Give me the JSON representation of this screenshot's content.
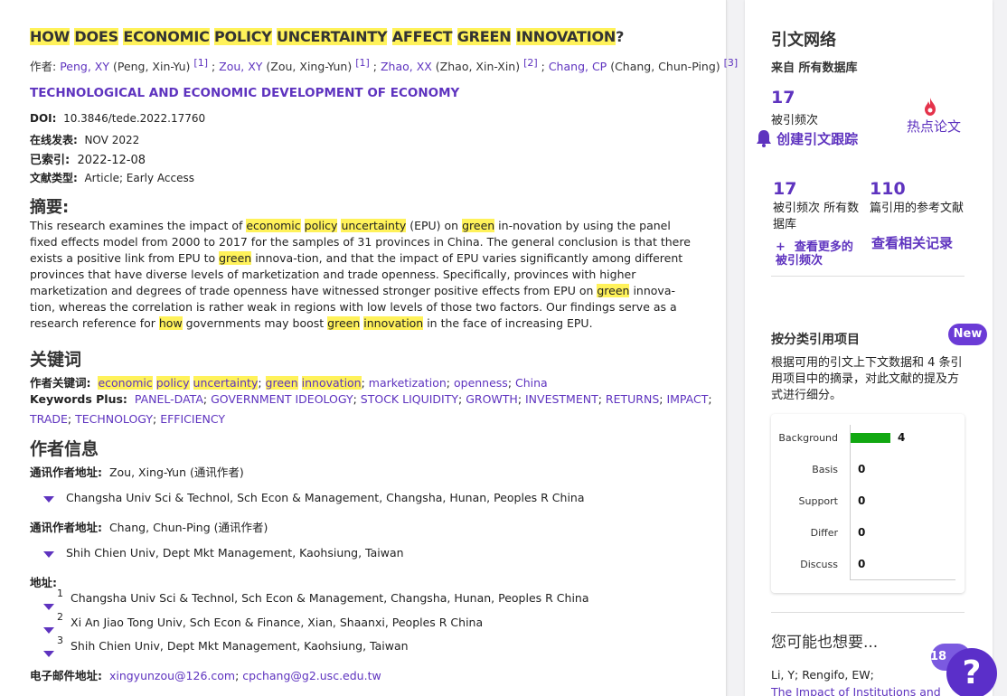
{
  "article": {
    "title_words": [
      {
        "t": "HOW",
        "hl": true
      },
      {
        "t": " ",
        "hl": false
      },
      {
        "t": "DOES",
        "hl": true
      },
      {
        "t": " ",
        "hl": false
      },
      {
        "t": "ECONOMIC",
        "hl": true
      },
      {
        "t": " ",
        "hl": false
      },
      {
        "t": "POLICY",
        "hl": true
      },
      {
        "t": " ",
        "hl": false
      },
      {
        "t": "UNCERTAINTY",
        "hl": true
      },
      {
        "t": " ",
        "hl": false
      },
      {
        "t": "AFFECT",
        "hl": true
      },
      {
        "t": " ",
        "hl": false
      },
      {
        "t": "GREEN",
        "hl": true
      },
      {
        "t": " ",
        "hl": false
      },
      {
        "t": "INNOVATION",
        "hl": true
      },
      {
        "t": "?",
        "hl": false
      }
    ],
    "authors_label": "作者:",
    "authors": [
      {
        "short": "Peng, XY",
        "full": "(Peng, Xin-Yu)",
        "ref": "[1]"
      },
      {
        "short": "Zou, XY",
        "full": "(Zou, Xing-Yun)",
        "ref": "[1]"
      },
      {
        "short": "Zhao, XX",
        "full": "(Zhao, Xin-Xin)",
        "ref": "[2]"
      },
      {
        "short": "Chang, CP",
        "full": "(Chang, Chun-Ping)",
        "ref": "[3]"
      }
    ],
    "journal": "TECHNOLOGICAL AND ECONOMIC DEVELOPMENT OF ECONOMY",
    "doi_label": "DOI:",
    "doi": "10.3846/tede.2022.17760",
    "online_label": "在线发表:",
    "online": "NOV 2022",
    "indexed_label": "已索引:",
    "indexed": "2022-12-08",
    "doctype_label": "文献类型:",
    "doctype": "Article; Early Access",
    "abstract_heading": "摘要:",
    "abstract_parts": [
      {
        "t": "This research examines the impact of ",
        "hl": false
      },
      {
        "t": "economic",
        "hl": true
      },
      {
        "t": " ",
        "hl": false
      },
      {
        "t": "policy",
        "hl": true
      },
      {
        "t": " ",
        "hl": false
      },
      {
        "t": "uncertainty",
        "hl": true
      },
      {
        "t": " (EPU) on ",
        "hl": false
      },
      {
        "t": "green",
        "hl": true
      },
      {
        "t": " in-novation by using the panel fixed effects model from 2000 to 2017 for the samples of 31 provinces in China. The general conclusion is that there exists a positive link from EPU to ",
        "hl": false
      },
      {
        "t": "green",
        "hl": true
      },
      {
        "t": " innova-tion, and that the impact of EPU varies significantly among different provinces that have diverse levels of marketization and trade openness. Specifically, provinces with higher marketization and degrees of trade openness have witnessed stronger positive effects from EPU on ",
        "hl": false
      },
      {
        "t": "green",
        "hl": true
      },
      {
        "t": " innova-tion, whereas the correlation is rather weak in regions with low levels of those two factors. Our findings serve as a research reference for ",
        "hl": false
      },
      {
        "t": "how",
        "hl": true
      },
      {
        "t": " governments may boost ",
        "hl": false
      },
      {
        "t": "green",
        "hl": true
      },
      {
        "t": " ",
        "hl": false
      },
      {
        "t": "innovation",
        "hl": true
      },
      {
        "t": " in the face of increasing EPU.",
        "hl": false
      }
    ],
    "keywords_heading": "关键词",
    "author_kw_label": "作者关键词:",
    "author_kw": [
      [
        {
          "t": "economic",
          "hl": true
        },
        {
          "t": " ",
          "hl": false
        },
        {
          "t": "policy",
          "hl": true
        },
        {
          "t": " ",
          "hl": false
        },
        {
          "t": "uncertainty",
          "hl": true
        }
      ],
      [
        {
          "t": "green",
          "hl": true
        },
        {
          "t": " ",
          "hl": false
        },
        {
          "t": "innovation",
          "hl": true
        }
      ],
      [
        {
          "t": "marketization",
          "hl": false
        }
      ],
      [
        {
          "t": "openness",
          "hl": false
        }
      ],
      [
        {
          "t": "China",
          "hl": false
        }
      ]
    ],
    "kw_plus_label": "Keywords Plus:",
    "kw_plus_line1": [
      "PANEL-DATA",
      "GOVERNMENT IDEOLOGY",
      "STOCK LIQUIDITY",
      "GROWTH",
      "INVESTMENT",
      "RETURNS",
      "IMPACT"
    ],
    "kw_plus_line2": [
      "TRADE",
      "TECHNOLOGY",
      "EFFICIENCY"
    ],
    "author_info_heading": "作者信息",
    "corr1_label": "通讯作者地址:",
    "corr1_name": "Zou, Xing-Yun (通讯作者)",
    "corr1_addr": "Changsha Univ Sci & Technol, Sch Econ & Management, Changsha, Hunan, Peoples R China",
    "corr2_label": "通讯作者地址:",
    "corr2_name": "Chang, Chun-Ping (通讯作者)",
    "corr2_addr": "Shih Chien Univ, Dept Mkt Management, Kaohsiung, Taiwan",
    "addr_label": "地址:",
    "addresses": [
      {
        "n": "1",
        "text": "Changsha Univ Sci & Technol, Sch Econ & Management, Changsha, Hunan, Peoples R China"
      },
      {
        "n": "2",
        "text": "Xi An Jiao Tong Univ, Sch Econ & Finance, Xian, Shaanxi, Peoples R China"
      },
      {
        "n": "3",
        "text": "Shih Chien Univ, Dept Mkt Management, Kaohsiung, Taiwan"
      }
    ],
    "email_label": "电子邮件地址:",
    "emails": [
      "xingyunzou@126.com",
      "cpchang@g2.usc.edu.tw"
    ]
  },
  "sidebar": {
    "title": "引文网络",
    "subtitle": "来自 所有数据库",
    "cited_count": "17",
    "cited_label": "被引频次",
    "create_alert": "创建引文跟踪",
    "hot_paper": "热点论文",
    "cited_all_count": "17",
    "cited_all_label": "被引频次 所有数据库",
    "refs_count": "110",
    "refs_label": "篇引用的参考文献",
    "see_more": "查看更多的被引频次",
    "see_related": "查看相关记录",
    "classify_title": "按分类引用项目",
    "new_badge": "New",
    "classify_desc": "根据可用的引文上下文数据和 4 条引用项目中的摘录，对此文献的提及方式进行细分。",
    "maybe_title": "您可能也想要...",
    "maybe_authors": "Li, Y; Rengifo, EW;",
    "maybe_link": "The Impact of Institutions and"
  },
  "chart_data": {
    "type": "bar",
    "orientation": "horizontal",
    "categories": [
      "Background",
      "Basis",
      "Support",
      "Differ",
      "Discuss"
    ],
    "values": [
      4,
      0,
      0,
      0,
      0
    ],
    "bar_color": "#12a812"
  },
  "help": {
    "badge": "18",
    "icon": "?"
  },
  "colors": {
    "accent": "#5e33bf",
    "highlight": "#fff25a"
  }
}
